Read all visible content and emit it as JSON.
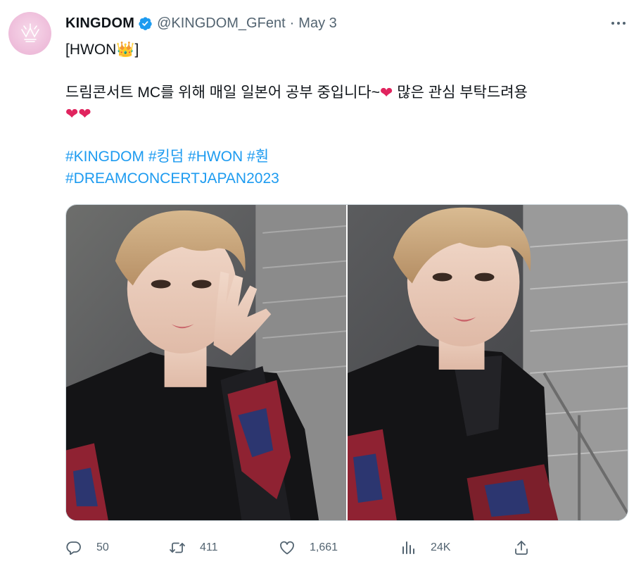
{
  "tweet": {
    "display_name": "KINGDOM",
    "handle": "@KINGDOM_GFent",
    "separator": "·",
    "date": "May 3",
    "line1": "[HWON👑]",
    "line2_text": "드림콘서트 MC를 위해 매일 일본어 공부 중입니다~",
    "line2_heart": "❤",
    "line2_tail": " 많은 관심 부탁드려용",
    "line3_hearts": "❤❤",
    "hashtag_1": "#KINGDOM",
    "hashtag_2": "#킹덤",
    "hashtag_3": "#HWON",
    "hashtag_4": "#훤",
    "hashtag_5": "#DREAMCONCERTJAPAN2023"
  },
  "actions": {
    "replies": "50",
    "retweets": "411",
    "likes": "1,661",
    "views": "24K"
  },
  "icons": {
    "avatar": "kingdom-logo-icon",
    "verified": "verified-badge-icon",
    "more": "more-options-icon",
    "reply": "reply-icon",
    "retweet": "retweet-icon",
    "like": "heart-icon",
    "views": "views-chart-icon",
    "share": "share-icon"
  },
  "colors": {
    "link": "#1d9bf0",
    "heart": "#e0245e",
    "muted": "#536471",
    "text": "#0f1419"
  }
}
